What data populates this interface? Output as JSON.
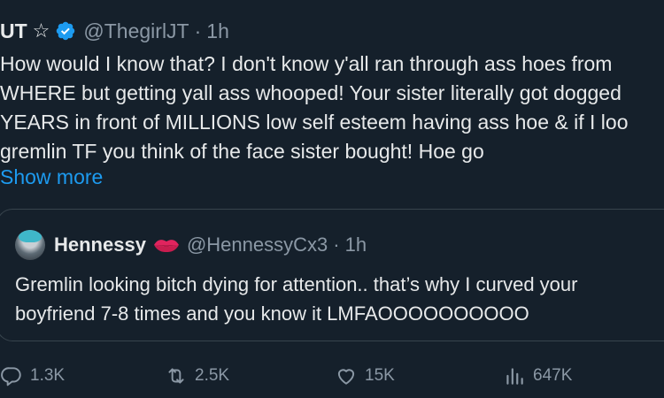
{
  "tweet": {
    "author_name": "UT",
    "star_icon": "☆",
    "handle": "@ThegirlJT",
    "separator": "·",
    "time": "1h",
    "text": "How would I know that? I don't know y'all ran through ass hoes from\nWHERE but getting yall ass whooped! Your sister literally got dogged\nYEARS in front of MILLIONS low self esteem having ass hoe & if I loo\ngremlin TF you think of the face sister bought! Hoe go",
    "show_more": "Show more"
  },
  "quote": {
    "author_name": "Hennessy",
    "handle": "@HennessyCx3",
    "separator": "·",
    "time": "1h",
    "text": "Gremlin looking bitch dying for attention.. that’s why I curved your\nboyfriend 7-8 times and you know it LMFAOOOOOOOOOO"
  },
  "actions": {
    "replies": "1.3K",
    "retweets": "2.5K",
    "likes": "15K",
    "views": "647K"
  },
  "colors": {
    "background": "#15202b",
    "text": "#e7e9ea",
    "secondary": "#8b98a5",
    "accent": "#1d9bf0",
    "border": "#38444d"
  },
  "icons": {
    "verified": "verified-badge-icon",
    "reply": "reply-icon",
    "retweet": "retweet-icon",
    "like": "heart-icon",
    "views": "views-bar-chart-icon",
    "lips": "lips-emoji-icon"
  }
}
